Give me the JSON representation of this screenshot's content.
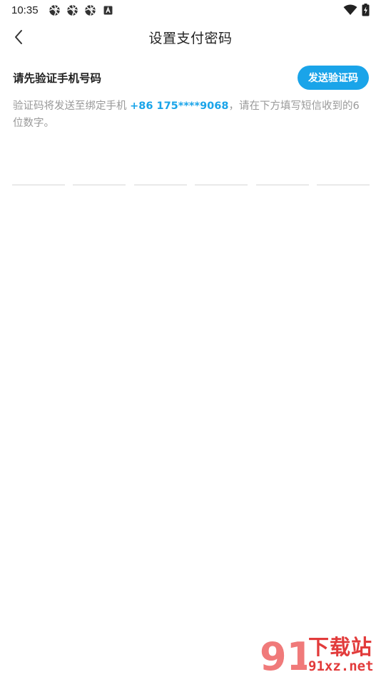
{
  "status_bar": {
    "time": "10:35",
    "notification_icons": [
      "aperture-icon",
      "aperture-icon",
      "aperture-icon",
      "a-badge-icon"
    ],
    "system_icons": [
      "wifi-icon",
      "battery-charging-icon"
    ]
  },
  "header": {
    "title": "设置支付密码",
    "back_icon": "chevron-left-icon"
  },
  "verify": {
    "prompt": "请先验证手机号码",
    "send_button": "发送验证码"
  },
  "info": {
    "prefix": "验证码将发送至绑定手机 ",
    "phone": "+86 175****9068",
    "suffix": "，请在下方填写短信收到的6位数字。"
  },
  "code_inputs": [
    "",
    "",
    "",
    "",
    "",
    ""
  ],
  "watermark": {
    "mark": "91",
    "title": "下载站",
    "url": "91xz.net"
  },
  "colors": {
    "accent": "#1aa4e9",
    "text_primary": "#222222",
    "text_secondary": "#999999",
    "input_line": "#d6d6d6",
    "watermark": "#e23b3b"
  }
}
